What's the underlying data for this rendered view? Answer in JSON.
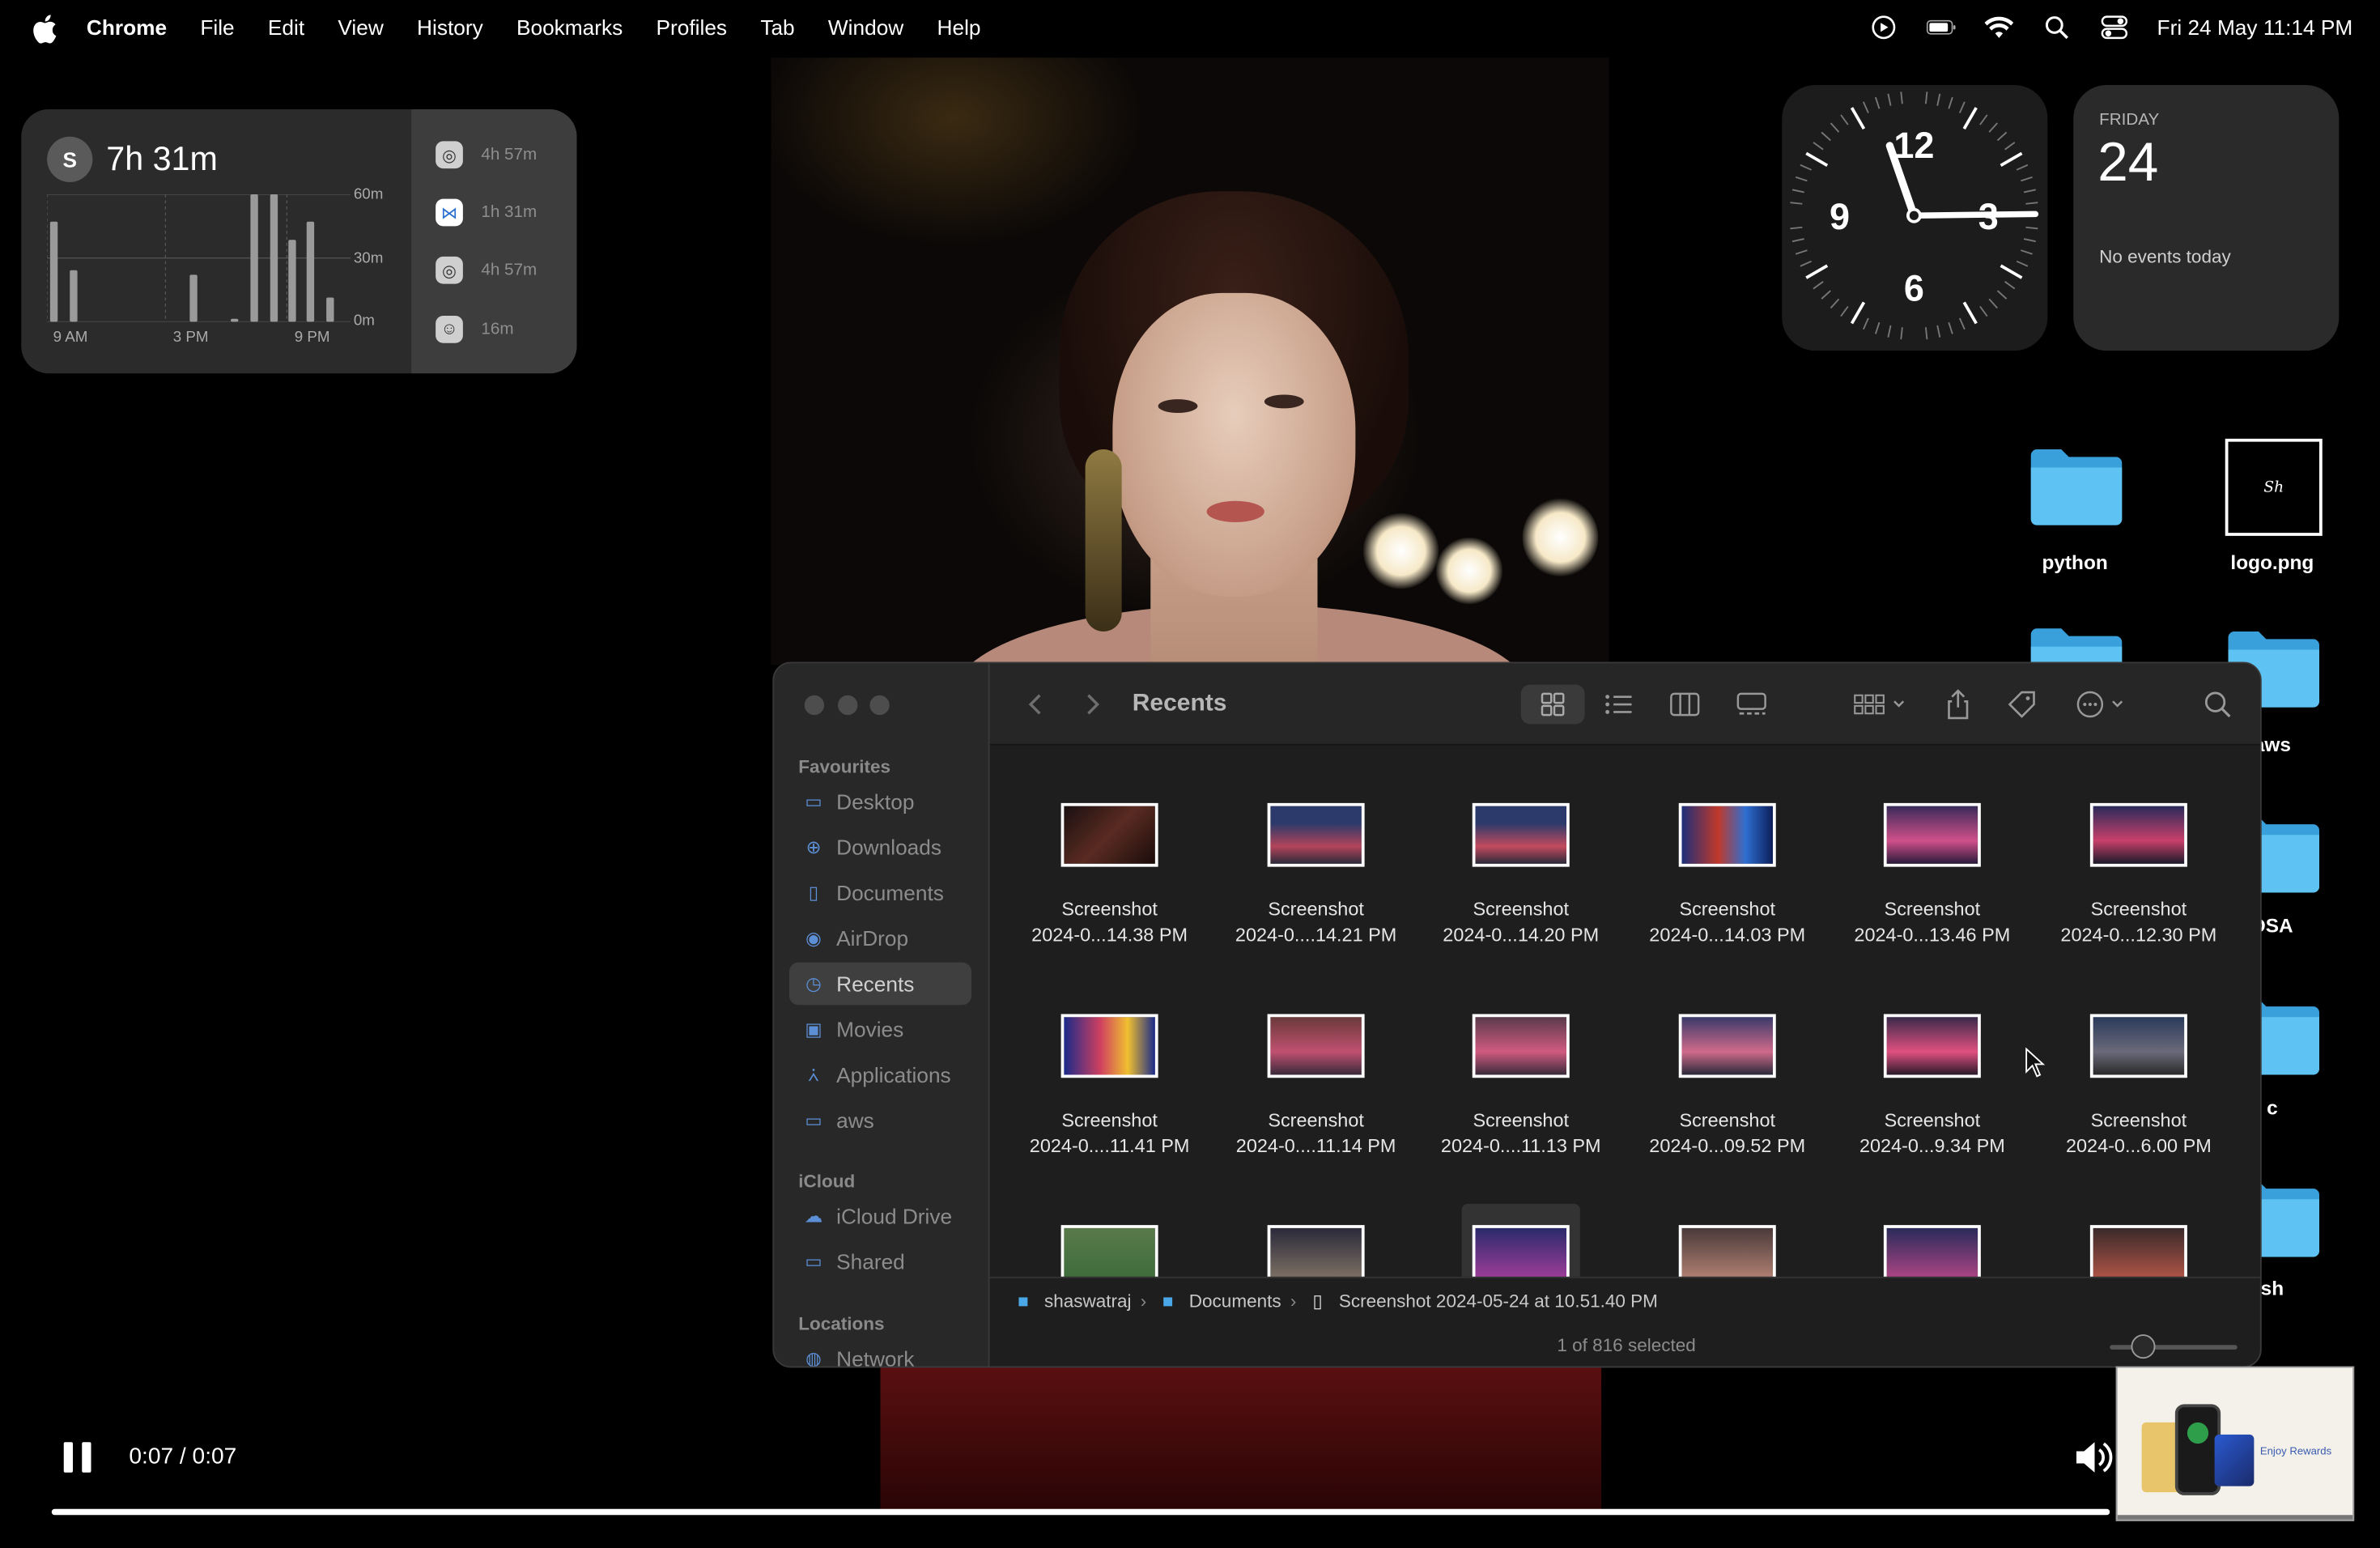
{
  "menubar": {
    "app": "Chrome",
    "items": [
      "File",
      "Edit",
      "View",
      "History",
      "Bookmarks",
      "Profiles",
      "Tab",
      "Window",
      "Help"
    ],
    "datetime": "Fri 24 May  11:14 PM"
  },
  "screentime": {
    "avatar_initial": "S",
    "total": "7h 31m",
    "y_ticks": [
      "60m",
      "30m",
      "0m"
    ],
    "x_ticks": [
      "9 AM",
      "3 PM",
      "9 PM"
    ],
    "apps": [
      {
        "icon": "chrome-icon",
        "time": "4h 57m"
      },
      {
        "icon": "vscode-icon",
        "time": "1h 31m"
      },
      {
        "icon": "chrome-icon",
        "time": "4h 57m"
      },
      {
        "icon": "finder-icon",
        "time": "16m"
      }
    ]
  },
  "clock": {
    "numbers": [
      "12",
      "3",
      "6",
      "9"
    ]
  },
  "calendar": {
    "day": "FRIDAY",
    "date": "24",
    "events": "No events today"
  },
  "desktop": {
    "items": [
      {
        "label": "python"
      },
      {
        "label": "logo.png"
      },
      {
        "label": "aws"
      },
      {
        "label": "DSA"
      },
      {
        "label": "c"
      },
      {
        "label": "sh"
      }
    ]
  },
  "finder": {
    "title": "Recents",
    "sidebar": {
      "favourites_header": "Favourites",
      "favourites": [
        "Desktop",
        "Downloads",
        "Documents",
        "AirDrop",
        "Recents",
        "Movies",
        "Applications",
        "aws"
      ],
      "icloud_header": "iCloud",
      "icloud": [
        "iCloud Drive",
        "Shared"
      ],
      "locations_header": "Locations",
      "locations": [
        "Network"
      ]
    },
    "files_row1": [
      {
        "name": "Screenshot",
        "date": "2024-0...14.38 PM"
      },
      {
        "name": "Screenshot",
        "date": "2024-0....14.21 PM"
      },
      {
        "name": "Screenshot",
        "date": "2024-0...14.20 PM"
      },
      {
        "name": "Screenshot",
        "date": "2024-0...14.03 PM"
      },
      {
        "name": "Screenshot",
        "date": "2024-0...13.46 PM"
      },
      {
        "name": "Screenshot",
        "date": "2024-0...12.30 PM"
      }
    ],
    "files_row2": [
      {
        "name": "Screenshot",
        "date": "2024-0....11.41 PM"
      },
      {
        "name": "Screenshot",
        "date": "2024-0....11.14 PM"
      },
      {
        "name": "Screenshot",
        "date": "2024-0....11.13 PM"
      },
      {
        "name": "Screenshot",
        "date": "2024-0...09.52 PM"
      },
      {
        "name": "Screenshot",
        "date": "2024-0...9.34 PM"
      },
      {
        "name": "Screenshot",
        "date": "2024-0...6.00 PM"
      }
    ],
    "path": [
      "shaswatraj",
      "Documents",
      "Screenshot 2024-05-24 at 10.51.40 PM"
    ],
    "status": "1 of 816 selected"
  },
  "player": {
    "time": "0:07 / 0:07",
    "progress": 1.0
  },
  "pip": {
    "caption": "Enjoy Rewards"
  }
}
